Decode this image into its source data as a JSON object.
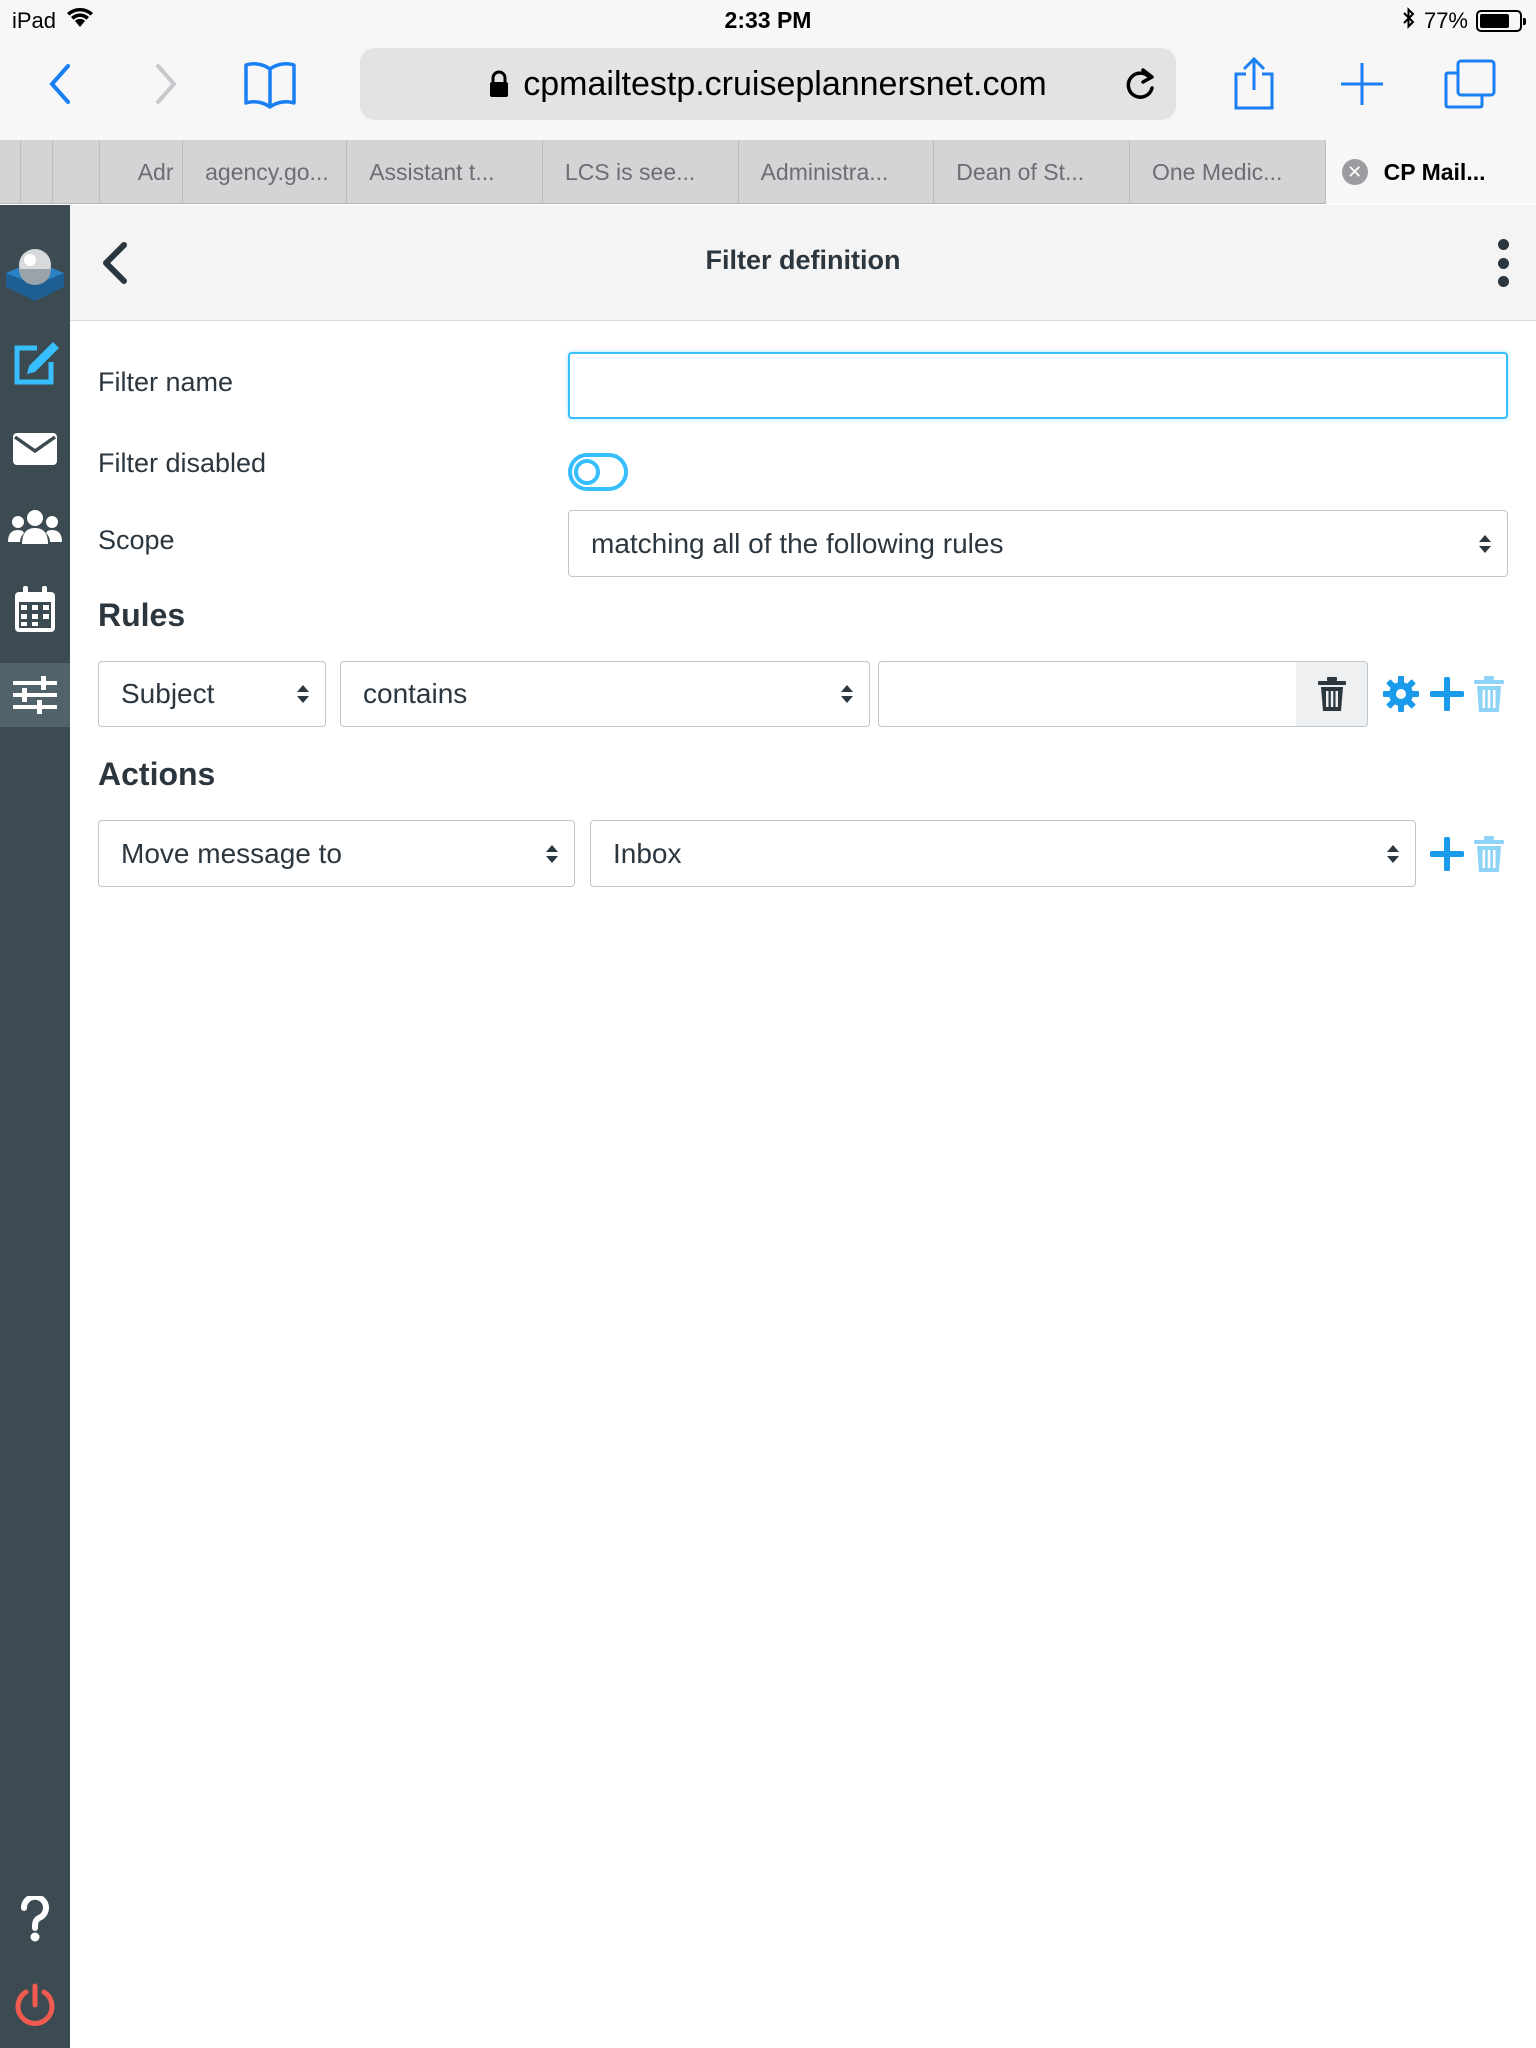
{
  "status_bar": {
    "device": "iPad",
    "time": "2:33 PM",
    "battery": "77%",
    "battery_level": 0.77
  },
  "browser": {
    "url": "cpmailtestp.cruiseplannersnet.com",
    "tabs": [
      {
        "label": ""
      },
      {
        "label": ""
      },
      {
        "label": ""
      },
      {
        "label": "Adr"
      },
      {
        "label": "agency.go..."
      },
      {
        "label": "Assistant t..."
      },
      {
        "label": "LCS is see..."
      },
      {
        "label": "Administra..."
      },
      {
        "label": "Dean of St..."
      },
      {
        "label": "One Medic..."
      },
      {
        "label": "CP Mail..."
      }
    ],
    "accent_color": "#1a7ff3"
  },
  "sidebar": {
    "items": [
      {
        "icon": "roundcube-logo-icon"
      },
      {
        "icon": "compose-icon"
      },
      {
        "icon": "mail-icon"
      },
      {
        "icon": "contacts-icon"
      },
      {
        "icon": "calendar-icon"
      },
      {
        "icon": "settings-sliders-icon"
      },
      {
        "icon": "help-icon"
      },
      {
        "icon": "logout-icon"
      }
    ]
  },
  "header": {
    "title": "Filter definition"
  },
  "form": {
    "filter_name_label": "Filter name",
    "filter_name_value": "",
    "filter_disabled_label": "Filter disabled",
    "filter_disabled": false,
    "scope_label": "Scope",
    "scope_value": "matching all of the following rules",
    "rules_title": "Rules",
    "rule": {
      "header": "Subject",
      "operator": "contains",
      "value": ""
    },
    "actions_title": "Actions",
    "action": {
      "type": "Move message to",
      "target": "Inbox"
    }
  },
  "colors": {
    "sidebar_bg": "#3c4a52",
    "accent_blue": "#37beff",
    "logout_red": "#f05a4f",
    "text": "#2c363f"
  }
}
